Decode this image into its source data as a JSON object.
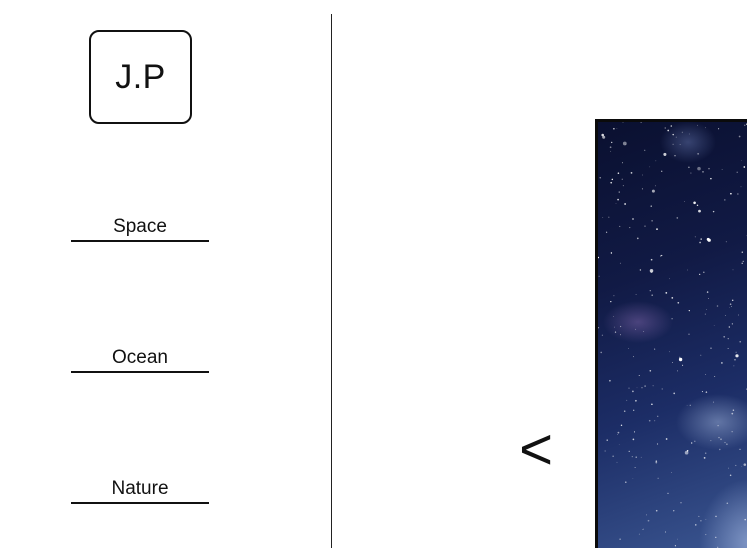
{
  "logo": {
    "text": "J.P"
  },
  "nav": {
    "items": [
      {
        "label": "Space"
      },
      {
        "label": "Ocean"
      },
      {
        "label": "Nature"
      }
    ]
  },
  "gallery": {
    "prev_label": "<",
    "image_subject": "starry-night-sky"
  },
  "colors": {
    "text": "#111111",
    "background": "#ffffff",
    "sky_dark": "#0a1030",
    "sky_light": "#3a5590"
  }
}
